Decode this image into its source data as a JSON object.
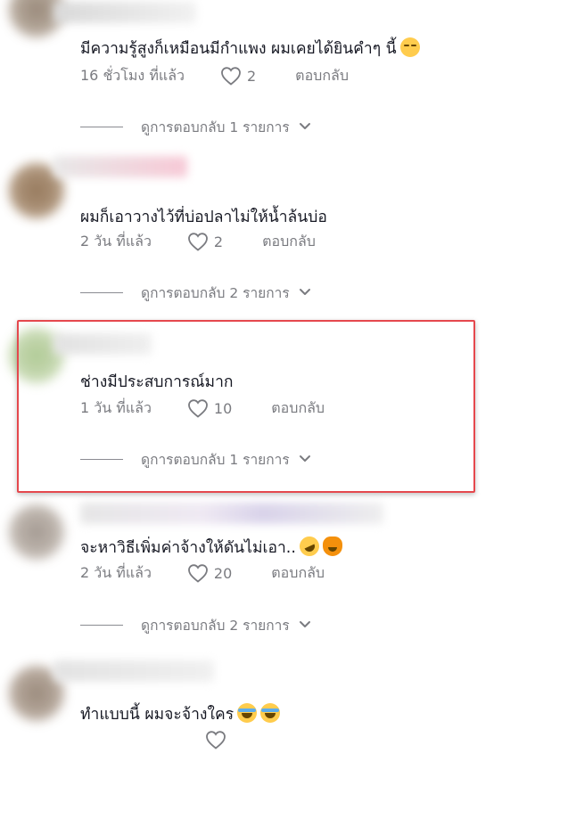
{
  "comments": [
    {
      "text": "มีความรู้สูงก็เหมือนมีกำแพง ผมเคยได้ยินคำๆ นี้",
      "emoji": [
        "pensive-face-emoji"
      ],
      "time": "16 ชั่วโมง ที่แล้ว",
      "likes": "2",
      "reply_label": "ตอบกลับ",
      "view_replies": "ดูการตอบกลับ 1 รายการ"
    },
    {
      "text": "ผมก็เอาวางไว้ที่บ่อปลาไม่ให้น้ำล้นบ่อ",
      "emoji": [],
      "time": "2 วัน ที่แล้ว",
      "likes": "2",
      "reply_label": "ตอบกลับ",
      "view_replies": "ดูการตอบกลับ 2 รายการ"
    },
    {
      "text": "ช่างมีประสบการณ์มาก",
      "emoji": [],
      "time": "1 วัน ที่แล้ว",
      "likes": "10",
      "reply_label": "ตอบกลับ",
      "view_replies": "ดูการตอบกลับ 1 รายการ",
      "highlighted": true
    },
    {
      "text": "จะหาวิธีเพิ่มค่าจ้างให้ดันไม่เอา..",
      "emoji": [
        "rofl-emoji",
        "weary-cat-emoji"
      ],
      "time": "2 วัน ที่แล้ว",
      "likes": "20",
      "reply_label": "ตอบกลับ",
      "view_replies": "ดูการตอบกลับ 2 รายการ"
    },
    {
      "text": "ทำแบบนี้ ผมจะจ้างใคร",
      "emoji": [
        "joy-emoji",
        "joy-emoji"
      ],
      "time": "",
      "likes": "",
      "reply_label": "",
      "view_replies": ""
    }
  ],
  "colors": {
    "text": "#161823",
    "meta": "#7a7b80",
    "highlight_border": "#e5484d"
  }
}
